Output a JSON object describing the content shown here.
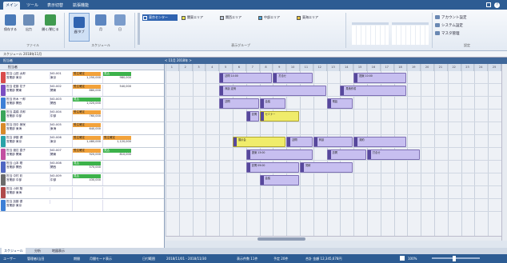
{
  "menu": {
    "tabs": [
      "メイン",
      "ツール",
      "表示切替",
      "拡張機能"
    ],
    "right_icons": [
      "minimize-icon",
      "help-icon"
    ]
  },
  "ribbon": {
    "buttons": [
      "保存する",
      "出力",
      "開く/閉じる",
      "週/タブ",
      "月",
      "日"
    ],
    "group_labels": [
      "ファイル",
      "スケジュール",
      "表示グループ",
      "設定"
    ],
    "chips": [
      {
        "label": "東京センター",
        "color": "#2f63b0",
        "active": true
      },
      {
        "label": "関東エリア",
        "color": "#e9e24a"
      },
      {
        "label": "関西エリア",
        "color": "#b8c4d6"
      },
      {
        "label": "中部エリア",
        "color": "#4aa3d9"
      },
      {
        "label": "東海エリア",
        "color": "#e7c23c"
      }
    ],
    "right_items": [
      "アカウント設定",
      "システム設定",
      "マスタ管理"
    ]
  },
  "addressbar": "スケジュール 2018年11月",
  "pane": {
    "left_title": "担当者",
    "grid_title": "< 11月 2018年 >"
  },
  "left": {
    "header": "担当者"
  },
  "days": [
    "1",
    "2",
    "3",
    "4",
    "5",
    "6",
    "7",
    "8",
    "9",
    "10",
    "11",
    "12",
    "13",
    "14",
    "15",
    "16",
    "17",
    "18",
    "19",
    "20",
    "21",
    "22",
    "23",
    "24",
    "25"
  ],
  "rows": [
    {
      "color": "#d94c4c",
      "name": "担当 山田 太郎",
      "sub": "営業部 東京",
      "code": "NO-001",
      "area": "東京",
      "s1": "1,250,000",
      "s2": "980,000",
      "b1": "受注確定",
      "b2": "見込"
    },
    {
      "color": "#7c4fc2",
      "name": "担当 佐藤 花子",
      "sub": "営業部 関東",
      "code": "NO-002",
      "area": "関東",
      "s1": "880,000",
      "s2": "540,000",
      "b1": "受注確定",
      "b2": ""
    },
    {
      "color": "#3d7fd6",
      "name": "担当 鈴木 一郎",
      "sub": "営業部 関西",
      "code": "NO-003",
      "area": "関西",
      "s1": "1,020,000",
      "s2": "",
      "b1": "見込",
      "b2": ""
    },
    {
      "color": "#3aa55a",
      "name": "担当 高橋 次郎",
      "sub": "営業部 中部",
      "code": "NO-004",
      "area": "中部",
      "s1": "760,000",
      "s2": "",
      "b1": "受注確定",
      "b2": ""
    },
    {
      "color": "#d88a2a",
      "name": "担当 田中 美咲",
      "sub": "営業部 東海",
      "code": "NO-005",
      "area": "東海",
      "s1": "640,000",
      "s2": "",
      "b1": "受注確定",
      "b2": ""
    },
    {
      "color": "#2aa3a8",
      "name": "担当 伊藤 健",
      "sub": "営業部 東京",
      "code": "NO-006",
      "area": "東京",
      "s1": "1,480,000",
      "s2": "1,120,000",
      "b1": "受注確定",
      "b2": "受注確定"
    },
    {
      "color": "#c24fa0",
      "name": "担当 渡辺 直子",
      "sub": "営業部 関東",
      "code": "NO-007",
      "area": "関東",
      "s1": "920,000",
      "s2": "810,000",
      "b1": "受注確定",
      "b2": "見込"
    },
    {
      "color": "#4f66c2",
      "name": "担当 山本 剛",
      "sub": "営業部 関西",
      "code": "NO-008",
      "area": "関西",
      "s1": "570,000",
      "s2": "",
      "b1": "見込",
      "b2": ""
    },
    {
      "color": "#6b6b6b",
      "name": "担当 中村 彩",
      "sub": "営業部 中部",
      "code": "NO-009",
      "area": "中部",
      "s1": "430,000",
      "s2": "",
      "b1": "見込",
      "b2": ""
    },
    {
      "color": "#b04a4a",
      "name": "担当 小林 翔",
      "sub": "営業部 東海",
      "code": "",
      "area": "",
      "s1": "",
      "s2": "",
      "b1": "",
      "b2": ""
    },
    {
      "color": "#3d7fd6",
      "name": "担当 加藤 優",
      "sub": "営業部 東京",
      "code": "",
      "area": "",
      "s1": "",
      "s2": "",
      "b1": "",
      "b2": ""
    }
  ],
  "bars": [
    {
      "row": 0,
      "start": 4,
      "end": 8,
      "label": "訪問 14:00",
      "yellow": false
    },
    {
      "row": 0,
      "start": 8,
      "end": 11,
      "label": "打合せ",
      "yellow": false
    },
    {
      "row": 0,
      "start": 14,
      "end": 18,
      "label": "提案 10:00",
      "yellow": false
    },
    {
      "row": 1,
      "start": 4,
      "end": 12,
      "label": "商談 定例",
      "yellow": false
    },
    {
      "row": 1,
      "start": 13,
      "end": 18,
      "label": "見積作成",
      "yellow": false
    },
    {
      "row": 2,
      "start": 4,
      "end": 7,
      "label": "訪問",
      "yellow": false
    },
    {
      "row": 2,
      "start": 7,
      "end": 9,
      "label": "会議",
      "yellow": false
    },
    {
      "row": 2,
      "start": 12,
      "end": 14,
      "label": "電話",
      "yellow": false
    },
    {
      "row": 3,
      "start": 6,
      "end": 7,
      "label": "訪問",
      "yellow": false
    },
    {
      "row": 3,
      "start": 7,
      "end": 10,
      "label": "セミナー",
      "yellow": true
    },
    {
      "row": 5,
      "start": 5,
      "end": 9,
      "label": "展示会",
      "yellow": true
    },
    {
      "row": 5,
      "start": 9,
      "end": 11,
      "label": "訪問",
      "yellow": false
    },
    {
      "row": 5,
      "start": 11,
      "end": 14,
      "label": "商談",
      "yellow": false
    },
    {
      "row": 5,
      "start": 14,
      "end": 18,
      "label": "契約",
      "yellow": false
    },
    {
      "row": 6,
      "start": 6,
      "end": 11,
      "label": "提案 13:00",
      "yellow": false
    },
    {
      "row": 6,
      "start": 12,
      "end": 15,
      "label": "訪問",
      "yellow": false
    },
    {
      "row": 6,
      "start": 15,
      "end": 19,
      "label": "打合せ",
      "yellow": false
    },
    {
      "row": 7,
      "start": 6,
      "end": 10,
      "label": "訪問 09:00",
      "yellow": false
    },
    {
      "row": 7,
      "start": 10,
      "end": 14,
      "label": "見積",
      "yellow": false
    },
    {
      "row": 8,
      "start": 7,
      "end": 10,
      "label": "会議",
      "yellow": false
    }
  ],
  "bottom_tabs": [
    "スケジュール",
    "分析",
    "地図表示"
  ],
  "status": {
    "items": [
      "ユーザー",
      "管理者/山田",
      "期間",
      "月間モード表示",
      "日付範囲",
      "2018/11/01 - 2018/11/30",
      "表示件数 11件",
      "予定 20件",
      "合計 金額 12,345,678円"
    ],
    "zoom": "100%"
  }
}
